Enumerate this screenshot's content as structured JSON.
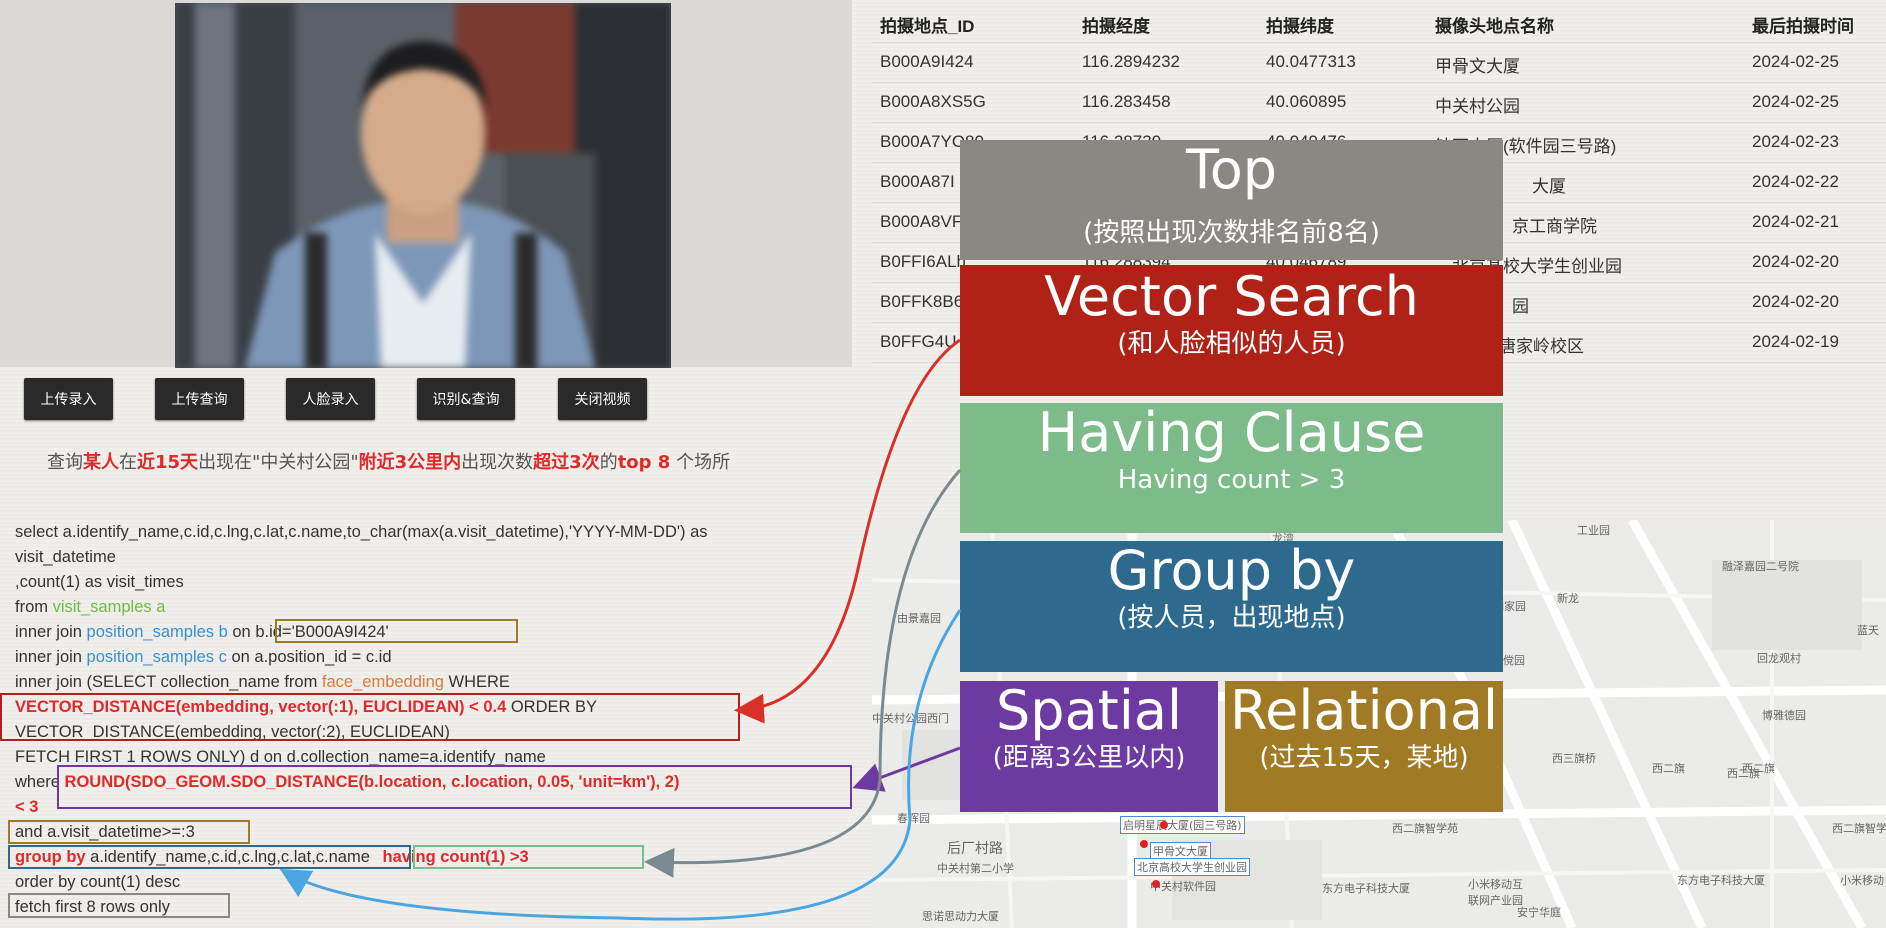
{
  "buttons": [
    "上传录入",
    "上传查询",
    "人脸录入",
    "识别&查询",
    "关闭视频"
  ],
  "query": {
    "p1": "查询",
    "p2": "某人",
    "p3": "在",
    "p4": "近15天",
    "p5": "出现在\"中关村公园\"",
    "p6": "附近3公里内",
    "p7": "出现次数",
    "p8": "超过3次",
    "p9": "的",
    "p10": "top 8",
    "p11": " 个场所"
  },
  "sql": {
    "l1": "select a.identify_name,c.id,c.lng,c.lat,c.name,to_char(max(a.visit_datetime),'YYYY-MM-DD') as",
    "l2": "visit_datetime",
    "l3": ",count(1) as visit_times",
    "l4a": "from ",
    "l4b": "visit_samples a",
    "l5a": "inner join ",
    "l5b": "position_samples b",
    "l5c": " on ",
    "l5d": "b.id='B000A9I424'",
    "l6a": "inner join ",
    "l6b": "position_samples c",
    "l6c": " on a.position_id = c.id",
    "l7a": "inner join (SELECT collection_name from ",
    "l7b": "face_embedding",
    "l7c": " WHERE",
    "l8a": "VECTOR_DISTANCE(embedding, vector(:1), EUCLIDEAN) < 0.4",
    "l8b": " ORDER BY",
    "l9": "VECTOR_DISTANCE(embedding, vector(:2), EUCLIDEAN)",
    "l10": "FETCH FIRST 1 ROWS ONLY) d on d.collection_name=a.identify_name",
    "l11a": "where ",
    "l11b": "ROUND(SDO_GEOM.SDO_DISTANCE(b.location, c.location, 0.05, 'unit=km'), 2)",
    "l12": "< 3",
    "l13": "and a.visit_datetime>=:3",
    "l14a": "group by",
    "l14b": " a.identify_name,c.id,c.lng,c.lat,c.name ",
    "l14c": "having count(1) >3",
    "l15": "order by count(1) desc",
    "l16": "fetch first 8 rows only"
  },
  "table": {
    "headers": [
      "拍摄地点_ID",
      "拍摄经度",
      "拍摄纬度",
      "摄像头地点名称",
      "最后拍摄时间"
    ],
    "rows": [
      [
        "B000A9I424",
        "116.2894232",
        "40.0477313",
        "甲骨文大厦",
        "2024-02-25"
      ],
      [
        "B000A8XS5G",
        "116.283458",
        "40.060895",
        "中关村公园",
        "2024-02-25"
      ],
      [
        "B000A7YO80",
        "116.28730",
        "40.049476",
        "钻石大厦(软件园三号路)",
        "2024-02-23"
      ],
      [
        "B000A87I",
        "",
        "",
        "大厦",
        "2024-02-22"
      ],
      [
        "B000A8VF",
        "",
        "",
        "京工商学院",
        "2024-02-21"
      ],
      [
        "B0FFI6ALh",
        "116.288394",
        "40.046789",
        "北京某校大学生创业园",
        "2024-02-20"
      ],
      [
        "B0FFK8B6",
        "",
        "",
        "园",
        "2024-02-20"
      ],
      [
        "B0FFG4U",
        "",
        "",
        "学唐家岭校区",
        "2024-02-19"
      ]
    ]
  },
  "map": {
    "labels": [
      "工业园",
      "融泽嘉园二号院",
      "万润家园",
      "新龙",
      "金傥园",
      "回龙观村",
      "蓝天",
      "中关村公园西门",
      "博雅德园",
      "西三旗桥",
      "西二旗",
      "春晖园",
      "后厂村路",
      "中关村第二小学",
      "西二旗智学苑",
      "东方电子科技大厦",
      "小米移动互联网产业园",
      "东方电子科技大厦",
      "小米移动",
      "安宁华庭",
      "西二旗",
      "西二旗",
      "思诺思动力大厦",
      "龙湾",
      "西二旗智学苑",
      "由景嘉园"
    ],
    "poi": [
      "启明星辰大厦(园三号路)",
      "甲骨文大厦",
      "北京高校大学生创业园",
      "中关村软件园"
    ]
  },
  "panels": {
    "top": {
      "big": "Top",
      "small": "(按照出现次数排名前8名)"
    },
    "vector": {
      "big": "Vector Search",
      "small": "(和人脸相似的人员)"
    },
    "having": {
      "big": "Having Clause",
      "small": "Having count > 3"
    },
    "group": {
      "big": "Group by",
      "small": "(按人员，出现地点)"
    },
    "spatial": {
      "big": "Spatial",
      "small": "(距离3公里以内)"
    },
    "relational": {
      "big": "Relational",
      "small": "(过去15天，某地)"
    }
  },
  "colors": {
    "top": "#8b8783",
    "vector": "#b02218",
    "having": "#7dbb8a",
    "group": "#2d6a8e",
    "spatial": "#6c3aa0",
    "relational": "#a07a25"
  }
}
